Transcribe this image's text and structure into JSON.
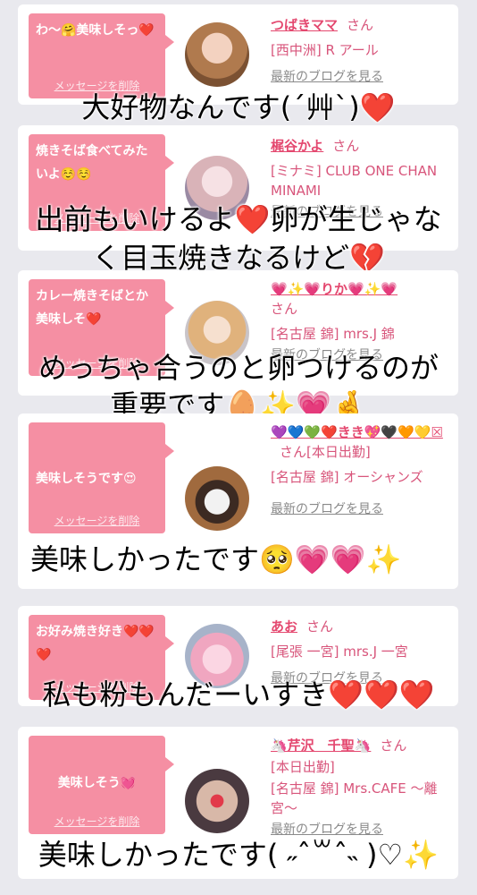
{
  "common": {
    "delete_label": "メッセージを削除",
    "latest_blog_label": "最新のブログを見る",
    "san": "さん"
  },
  "entries": [
    {
      "message": "わ〜🤗美味しそっ❤️",
      "name": "つばきママ",
      "place": "[西中洲] R アール",
      "caption": "大好物なんです(´艸`)❤️"
    },
    {
      "message": "焼きそば食べてみたいよ☺️☺️",
      "name": "梶谷かよ",
      "place": "[ミナミ] CLUB ONE CHAN MINAMI",
      "caption_line1": "出前もいけるよ❤️卵が生じゃな",
      "caption_line2": "く目玉焼きなるけど💔"
    },
    {
      "message": "カレー焼きそばとか美味しそ❤️",
      "name": "💗✨💗りか💗✨💗",
      "place": "[名古屋 錦] mrs.J 錦",
      "caption_line1": "めっちゃ合うのと卵つけるのが",
      "caption_line2": "重要です🥚✨💗🤞"
    },
    {
      "message": "美味しそうです😍",
      "name": "💜💙💚❤️きき💖🖤🧡💛☒",
      "name_suffix": "さん[本日出勤]",
      "place": "[名古屋 錦] オーシャンズ",
      "caption": "美味しかったです🥺💗💗✨"
    },
    {
      "message": "お好み焼き好き❤️❤️❤️",
      "name": "あお",
      "place": "[尾張 一宮] mrs.J 一宮",
      "caption": "私も粉もんだーいすき❤️❤️❤️"
    },
    {
      "message": "美味しそう💓",
      "name": "🦄芹沢　千聖🦄",
      "status": "[本日出勤]",
      "place": "[名古屋 錦] Mrs.CAFE 〜離宮〜",
      "caption": "美味しかったです( ˶ˆ꒳ˆ˵ )♡✨"
    }
  ]
}
